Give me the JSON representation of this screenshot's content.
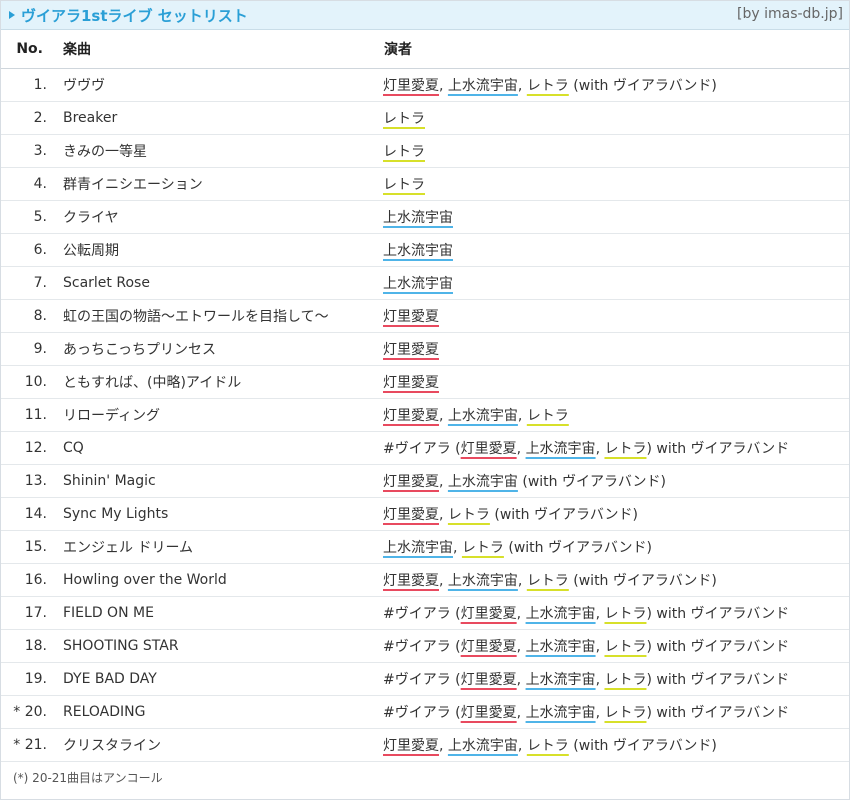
{
  "header": {
    "title": "ヴイアラ1stライブ セットリスト",
    "source": "[by imas-db.jp]"
  },
  "columns": {
    "no": "No.",
    "song": "楽曲",
    "performer": "演者"
  },
  "members": {
    "akari": {
      "name": "灯里愛夏",
      "color": "#e84a5f"
    },
    "mizu": {
      "name": "上水流宇宙",
      "color": "#4fb4e8"
    },
    "retora": {
      "name": "レトラ",
      "color": "#d7e02a"
    }
  },
  "rows": [
    {
      "no": "1.",
      "song": "ヴヴヴ",
      "performers": [
        "akari",
        "mizu",
        "retora"
      ],
      "suffix": " (with ヴイアラバンド)"
    },
    {
      "no": "2.",
      "song": "Breaker",
      "performers": [
        "retora"
      ]
    },
    {
      "no": "3.",
      "song": "きみの一等星",
      "performers": [
        "retora"
      ]
    },
    {
      "no": "4.",
      "song": "群青イニシエーション",
      "performers": [
        "retora"
      ]
    },
    {
      "no": "5.",
      "song": "クライヤ",
      "performers": [
        "mizu"
      ]
    },
    {
      "no": "6.",
      "song": "公転周期",
      "performers": [
        "mizu"
      ]
    },
    {
      "no": "7.",
      "song": "Scarlet Rose",
      "performers": [
        "mizu"
      ]
    },
    {
      "no": "8.",
      "song": "虹の王国の物語〜エトワールを目指して〜",
      "performers": [
        "akari"
      ]
    },
    {
      "no": "9.",
      "song": "あっちこっちプリンセス",
      "performers": [
        "akari"
      ]
    },
    {
      "no": "10.",
      "song": "ともすれば、(中略)アイドル",
      "performers": [
        "akari"
      ]
    },
    {
      "no": "11.",
      "song": "リローディング",
      "performers": [
        "akari",
        "mizu",
        "retora"
      ]
    },
    {
      "no": "12.",
      "song": "CQ",
      "prefix": "#ヴイアラ (",
      "performers": [
        "akari",
        "mizu",
        "retora"
      ],
      "suffix": ") with ヴイアラバンド"
    },
    {
      "no": "13.",
      "song": "Shinin' Magic",
      "performers": [
        "akari",
        "mizu"
      ],
      "suffix": " (with ヴイアラバンド)"
    },
    {
      "no": "14.",
      "song": "Sync My Lights",
      "performers": [
        "akari",
        "retora"
      ],
      "suffix": " (with ヴイアラバンド)"
    },
    {
      "no": "15.",
      "song": "エンジェル ドリーム",
      "performers": [
        "mizu",
        "retora"
      ],
      "suffix": " (with ヴイアラバンド)"
    },
    {
      "no": "16.",
      "song": "Howling over the World",
      "performers": [
        "akari",
        "mizu",
        "retora"
      ],
      "suffix": " (with ヴイアラバンド)"
    },
    {
      "no": "17.",
      "song": "FIELD ON ME",
      "prefix": "#ヴイアラ (",
      "performers": [
        "akari",
        "mizu",
        "retora"
      ],
      "suffix": ") with ヴイアラバンド"
    },
    {
      "no": "18.",
      "song": "SHOOTING STAR",
      "prefix": "#ヴイアラ (",
      "performers": [
        "akari",
        "mizu",
        "retora"
      ],
      "suffix": ") with ヴイアラバンド"
    },
    {
      "no": "19.",
      "song": "DYE BAD DAY",
      "prefix": "#ヴイアラ (",
      "performers": [
        "akari",
        "mizu",
        "retora"
      ],
      "suffix": ") with ヴイアラバンド"
    },
    {
      "no": "* 20.",
      "song": "RELOADING",
      "prefix": "#ヴイアラ (",
      "performers": [
        "akari",
        "mizu",
        "retora"
      ],
      "suffix": ") with ヴイアラバンド"
    },
    {
      "no": "* 21.",
      "song": "クリスタライン",
      "performers": [
        "akari",
        "mizu",
        "retora"
      ],
      "suffix": " (with ヴイアラバンド)"
    }
  ],
  "footnote": "(*) 20-21曲目はアンコール"
}
